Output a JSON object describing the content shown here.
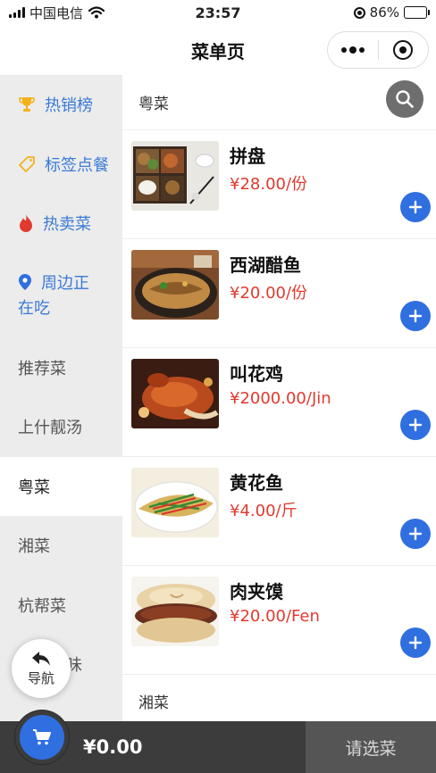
{
  "status_bar": {
    "carrier": "中国电信",
    "time": "23:57",
    "battery": "86%",
    "battery_level": 0.86
  },
  "nav": {
    "title": "菜单页"
  },
  "sidebar": {
    "items": [
      {
        "label": "热销榜",
        "icon": "trophy-icon"
      },
      {
        "label": "标签点餐",
        "icon": "tag-icon"
      },
      {
        "label": "热卖菜",
        "icon": "flame-icon"
      },
      {
        "label": "周边正在吃",
        "icon": "location-pin-icon"
      },
      {
        "label": "推荐菜"
      },
      {
        "label": "上什靓汤"
      },
      {
        "label": "粤菜"
      },
      {
        "label": "湘菜"
      },
      {
        "label": "杭帮菜"
      },
      {
        "label": "特色美味"
      }
    ],
    "active_label": "粤菜"
  },
  "main": {
    "sections": [
      {
        "title": "粤菜"
      },
      {
        "title": "湘菜"
      }
    ],
    "dishes": [
      {
        "name": "拼盘",
        "price": "¥28.00/份"
      },
      {
        "name": "西湖醋鱼",
        "price": "¥20.00/份"
      },
      {
        "name": "叫花鸡",
        "price": "¥2000.00/Jin"
      },
      {
        "name": "黄花鱼",
        "price": "¥4.00/斤"
      },
      {
        "name": "肉夹馍",
        "price": "¥20.00/Fen"
      }
    ]
  },
  "guide": {
    "label": "导航"
  },
  "cart": {
    "total": "¥0.00",
    "choose_label": "请选菜"
  },
  "colors": {
    "accent": "#2f6fe0",
    "price": "#e03a2f",
    "sidebar_special": "#3a7bd5",
    "bottom_bar": "#3c3c3c"
  }
}
